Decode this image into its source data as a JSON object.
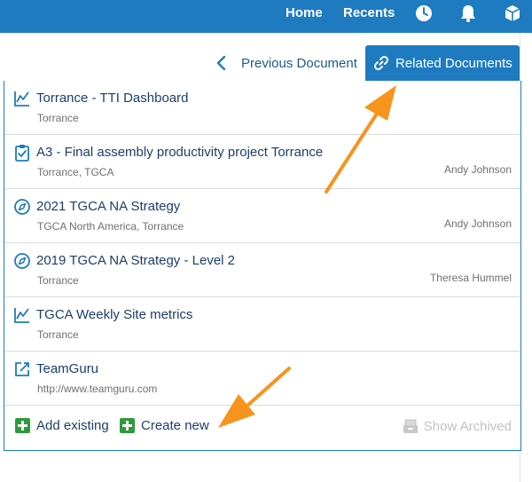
{
  "navbar": {
    "home_label": "Home",
    "recents_label": "Recents",
    "icons": [
      "clock-icon",
      "bell-icon",
      "cube-icon"
    ]
  },
  "tabs": {
    "previous_label": "Previous Document",
    "related_label": "Related Documents"
  },
  "related": {
    "items": [
      {
        "icon": "chart-line-icon",
        "title": "Torrance - TTI Dashboard",
        "subtitle": "Torrance",
        "owner": ""
      },
      {
        "icon": "clipboard-check-icon",
        "title": "A3 - Final assembly productivity project Torrance",
        "subtitle": "Torrance, TGCA",
        "owner": "Andy Johnson"
      },
      {
        "icon": "compass-icon",
        "title": "2021 TGCA NA Strategy",
        "subtitle": "TGCA North America, Torrance",
        "owner": "Andy Johnson"
      },
      {
        "icon": "compass-icon",
        "title": "2019 TGCA NA Strategy - Level 2",
        "subtitle": "Torrance",
        "owner": "Theresa Hummel"
      },
      {
        "icon": "chart-line-icon",
        "title": "TGCA Weekly Site metrics",
        "subtitle": "Torrance",
        "owner": ""
      },
      {
        "icon": "external-link-icon",
        "title": "TeamGuru",
        "subtitle": "http://www.teamguru.com",
        "owner": ""
      }
    ],
    "add_existing_label": "Add existing",
    "create_new_label": "Create new",
    "show_archived_label": "Show Archived"
  },
  "colors": {
    "brand_blue": "#1e7bc0",
    "title_navy": "#1d3e6b",
    "add_green": "#2f9a3a",
    "annotation_orange": "#f7941d"
  }
}
